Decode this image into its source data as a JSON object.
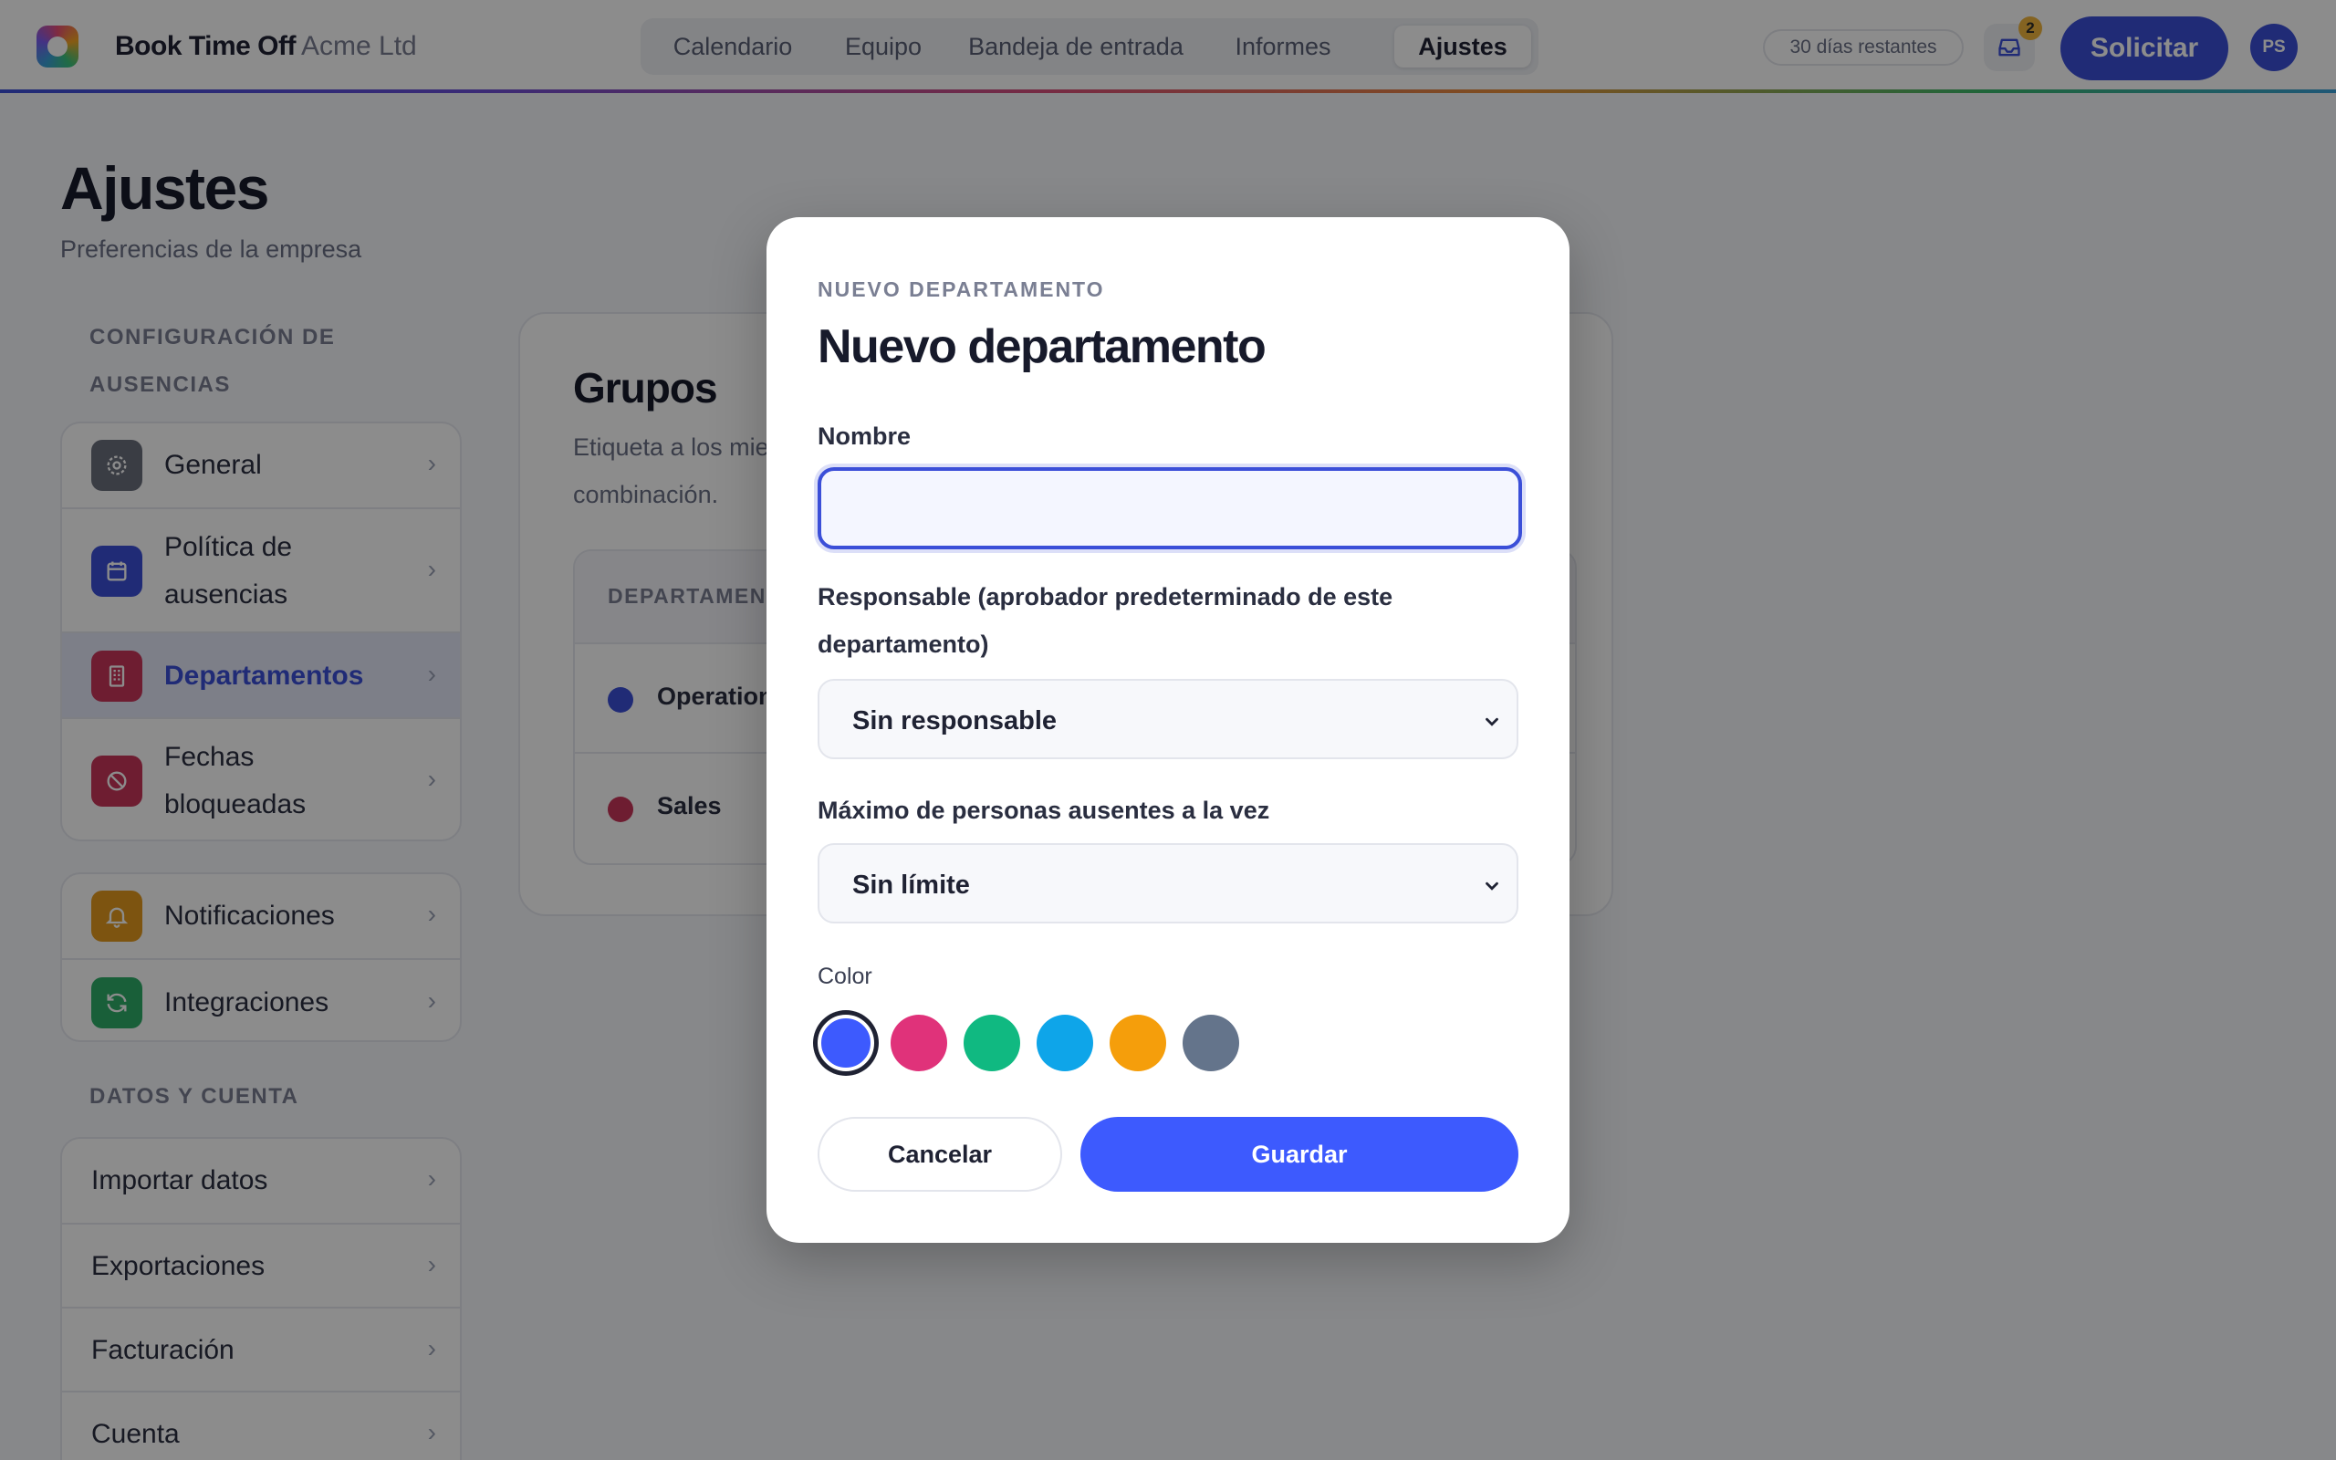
{
  "app": {
    "name": "Book Time Off",
    "org": "Acme Ltd"
  },
  "nav": {
    "tabs": [
      {
        "label": "Calendario",
        "active": false
      },
      {
        "label": "Equipo",
        "active": false
      },
      {
        "label": "Bandeja de entrada",
        "active": false
      },
      {
        "label": "Informes",
        "active": false
      },
      {
        "label": "Ajustes",
        "active": true
      }
    ]
  },
  "header": {
    "days_left": "30 días restantes",
    "inbox_badge": "2",
    "request_label": "Solicitar",
    "avatar_initials": "PS"
  },
  "page": {
    "title": "Ajustes",
    "subtitle": "Preferencias de la empresa"
  },
  "sidebar": {
    "section1": "CONFIGURACIÓN DE AUSENCIAS",
    "group1": [
      {
        "label": "General",
        "icon": "gear-icon",
        "color": "#6b6f7d",
        "active": false
      },
      {
        "label": "Política de ausencias",
        "icon": "calendar-icon",
        "color": "#3b4fd8",
        "active": false
      },
      {
        "label": "Departamentos",
        "icon": "building-icon",
        "color": "#c8365a",
        "active": true
      },
      {
        "label": "Fechas bloqueadas",
        "icon": "block-icon",
        "color": "#c8365a",
        "active": false
      }
    ],
    "group2": [
      {
        "label": "Notificaciones",
        "icon": "bell-icon",
        "color": "#e39a1e"
      },
      {
        "label": "Integraciones",
        "icon": "refresh-icon",
        "color": "#2fae68"
      }
    ],
    "section2": "DATOS Y CUENTA",
    "group3": [
      {
        "label": "Importar datos"
      },
      {
        "label": "Exportaciones"
      },
      {
        "label": "Facturación"
      },
      {
        "label": "Cuenta"
      }
    ]
  },
  "main": {
    "title": "Grupos",
    "desc_partial": "Etiqueta a los mie",
    "desc_line2": "combinación.",
    "table_header": "DEPARTAMENT",
    "rows": [
      {
        "name": "Operation",
        "color": "#3b4fd8"
      },
      {
        "name": "Sales",
        "color": "#c8365a"
      }
    ]
  },
  "modal": {
    "eyebrow": "NUEVO DEPARTAMENTO",
    "title": "Nuevo departamento",
    "name_label": "Nombre",
    "name_value": "",
    "manager_label": "Responsable (aprobador predeterminado de este departamento)",
    "manager_value": "Sin responsable",
    "max_label": "Máximo de personas ausentes a la vez",
    "max_value": "Sin límite",
    "color_label": "Color",
    "colors": [
      "#3d5afe",
      "#e0327a",
      "#10b981",
      "#0ea5e9",
      "#f59e0b",
      "#64748b"
    ],
    "selected_color": "#3d5afe",
    "cancel_label": "Cancelar",
    "save_label": "Guardar"
  }
}
